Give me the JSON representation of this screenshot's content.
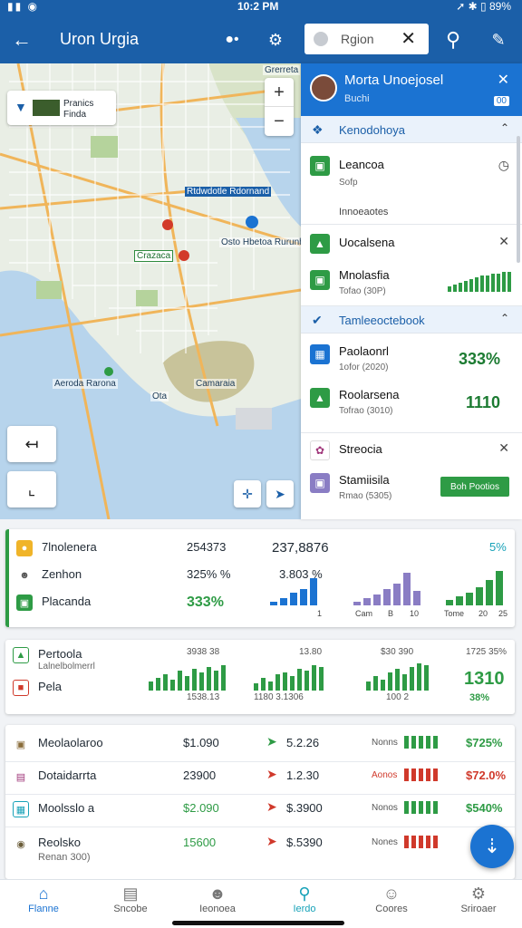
{
  "status": {
    "time": "10:2 PM",
    "battery": "89%",
    "left": "▮▮ ◉",
    "right_icons": "➚ ✱ ▯"
  },
  "appbar": {
    "title": "Uron Urgia",
    "search_text": "Rgion"
  },
  "map": {
    "card": {
      "title": "Pranics",
      "subtitle": "Finda"
    },
    "labels": [
      "Aeroda Rarona",
      "Camaraia",
      "Ota",
      "Osto Hbetoa Rurunhon",
      "Crazaca",
      "Grerreta"
    ],
    "blue_label": "Rtdwdotle Rdornand"
  },
  "panel": {
    "header": {
      "name": "Morta Unoejosel",
      "sub": "Buchi",
      "badge": "00"
    },
    "sections": [
      {
        "title": "Kenodohoya"
      },
      {
        "title": "Tamleeoctebook"
      }
    ],
    "items": [
      {
        "title": "Leancoa",
        "sub": "Sofp",
        "note": "Innoeaotes"
      },
      {
        "title": "Uocalsena"
      },
      {
        "title": "Mnolasfia",
        "sub": "Tofao (30P)"
      },
      {
        "title": "Paolaonrl",
        "sub": "1ofor (2020)",
        "value": "333%"
      },
      {
        "title": "Roolarsena",
        "sub": "Tofrao (3010)",
        "value": "1110"
      },
      {
        "title": "Streocia"
      },
      {
        "title": "Stamiisila",
        "sub": "Rmao (5305)",
        "button": "Boh Pootios"
      }
    ]
  },
  "card1": {
    "rows": [
      {
        "label": "7lnolenera",
        "v1": "254373",
        "v2": "237,8876",
        "v3": "5%"
      },
      {
        "label": "Zenhon",
        "v1": "325% %",
        "v2": "3.803 %"
      },
      {
        "label": "Placanda",
        "v1": "333%"
      }
    ],
    "axis": [
      "1",
      "Cam",
      "B",
      "10",
      "Tome",
      "20",
      "25"
    ]
  },
  "card2": {
    "rows": [
      {
        "label": "Pertoola",
        "sub": "Lalnelbolmerrl",
        "vals": [
          "3938 38",
          "13.80",
          "$30 390",
          "1725 35%"
        ]
      },
      {
        "label": "Pela",
        "vals": [
          "1538.13",
          "1180 3.1306",
          "100 2",
          "1310",
          "38%"
        ]
      }
    ]
  },
  "card3": {
    "rows": [
      {
        "label": "Meolaolaroo",
        "v1": "$1.090",
        "v2": "5.2.26",
        "tag": "Nonns",
        "pct": "$725%"
      },
      {
        "label": "Dotaidarrta",
        "v1": "23900",
        "v2": "1.2.30",
        "tag": "Aonos",
        "pct": "$72.0%"
      },
      {
        "label": "Moolsslo a",
        "v1": "$2.090",
        "v2": "$.3900",
        "tag": "Nonos",
        "pct": "$540%"
      },
      {
        "label": "Reolsko",
        "sub": "Renan 300)",
        "v1": "15600",
        "v2": "$.5390",
        "tag": "Nones",
        "pct": ""
      }
    ]
  },
  "nav": [
    {
      "label": "Flanne"
    },
    {
      "label": "Sncobe"
    },
    {
      "label": "Ieonoea"
    },
    {
      "label": "Ierdo"
    },
    {
      "label": "Coores"
    },
    {
      "label": "Sriroaer"
    }
  ],
  "colors": {
    "primary": "#1b5fa8",
    "accent": "#1b73d2",
    "green": "#2e9b45",
    "red": "#d0392b",
    "purple": "#8a7dc4"
  }
}
